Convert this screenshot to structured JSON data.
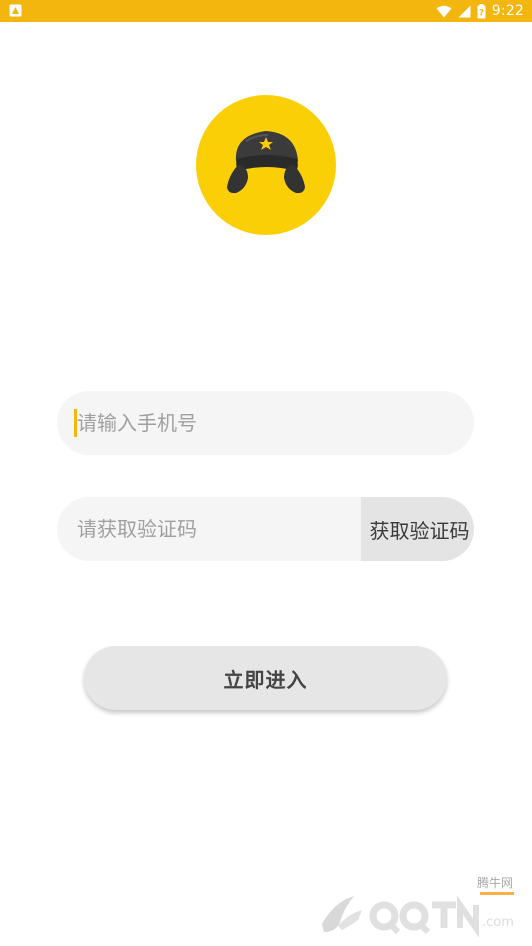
{
  "status_bar": {
    "time": "9:22",
    "icons": [
      "notification-icon",
      "wifi-icon",
      "signal-icon",
      "battery-icon"
    ],
    "background": "#f2b60f"
  },
  "logo": {
    "icon": "fur-hat-icon",
    "background": "#fbcf05"
  },
  "login": {
    "phone_placeholder": "请输入手机号",
    "phone_value": "",
    "code_placeholder": "请获取验证码",
    "code_value": "",
    "get_code_label": "获取验证码",
    "submit_label": "立即进入"
  },
  "watermark": {
    "text": "腾牛网",
    "brand": "QQTN.com"
  },
  "colors": {
    "accent": "#f2b60f",
    "logo_yellow": "#fbcf05",
    "field_bg": "#f5f5f5",
    "button_bg": "#e6e6e6"
  }
}
